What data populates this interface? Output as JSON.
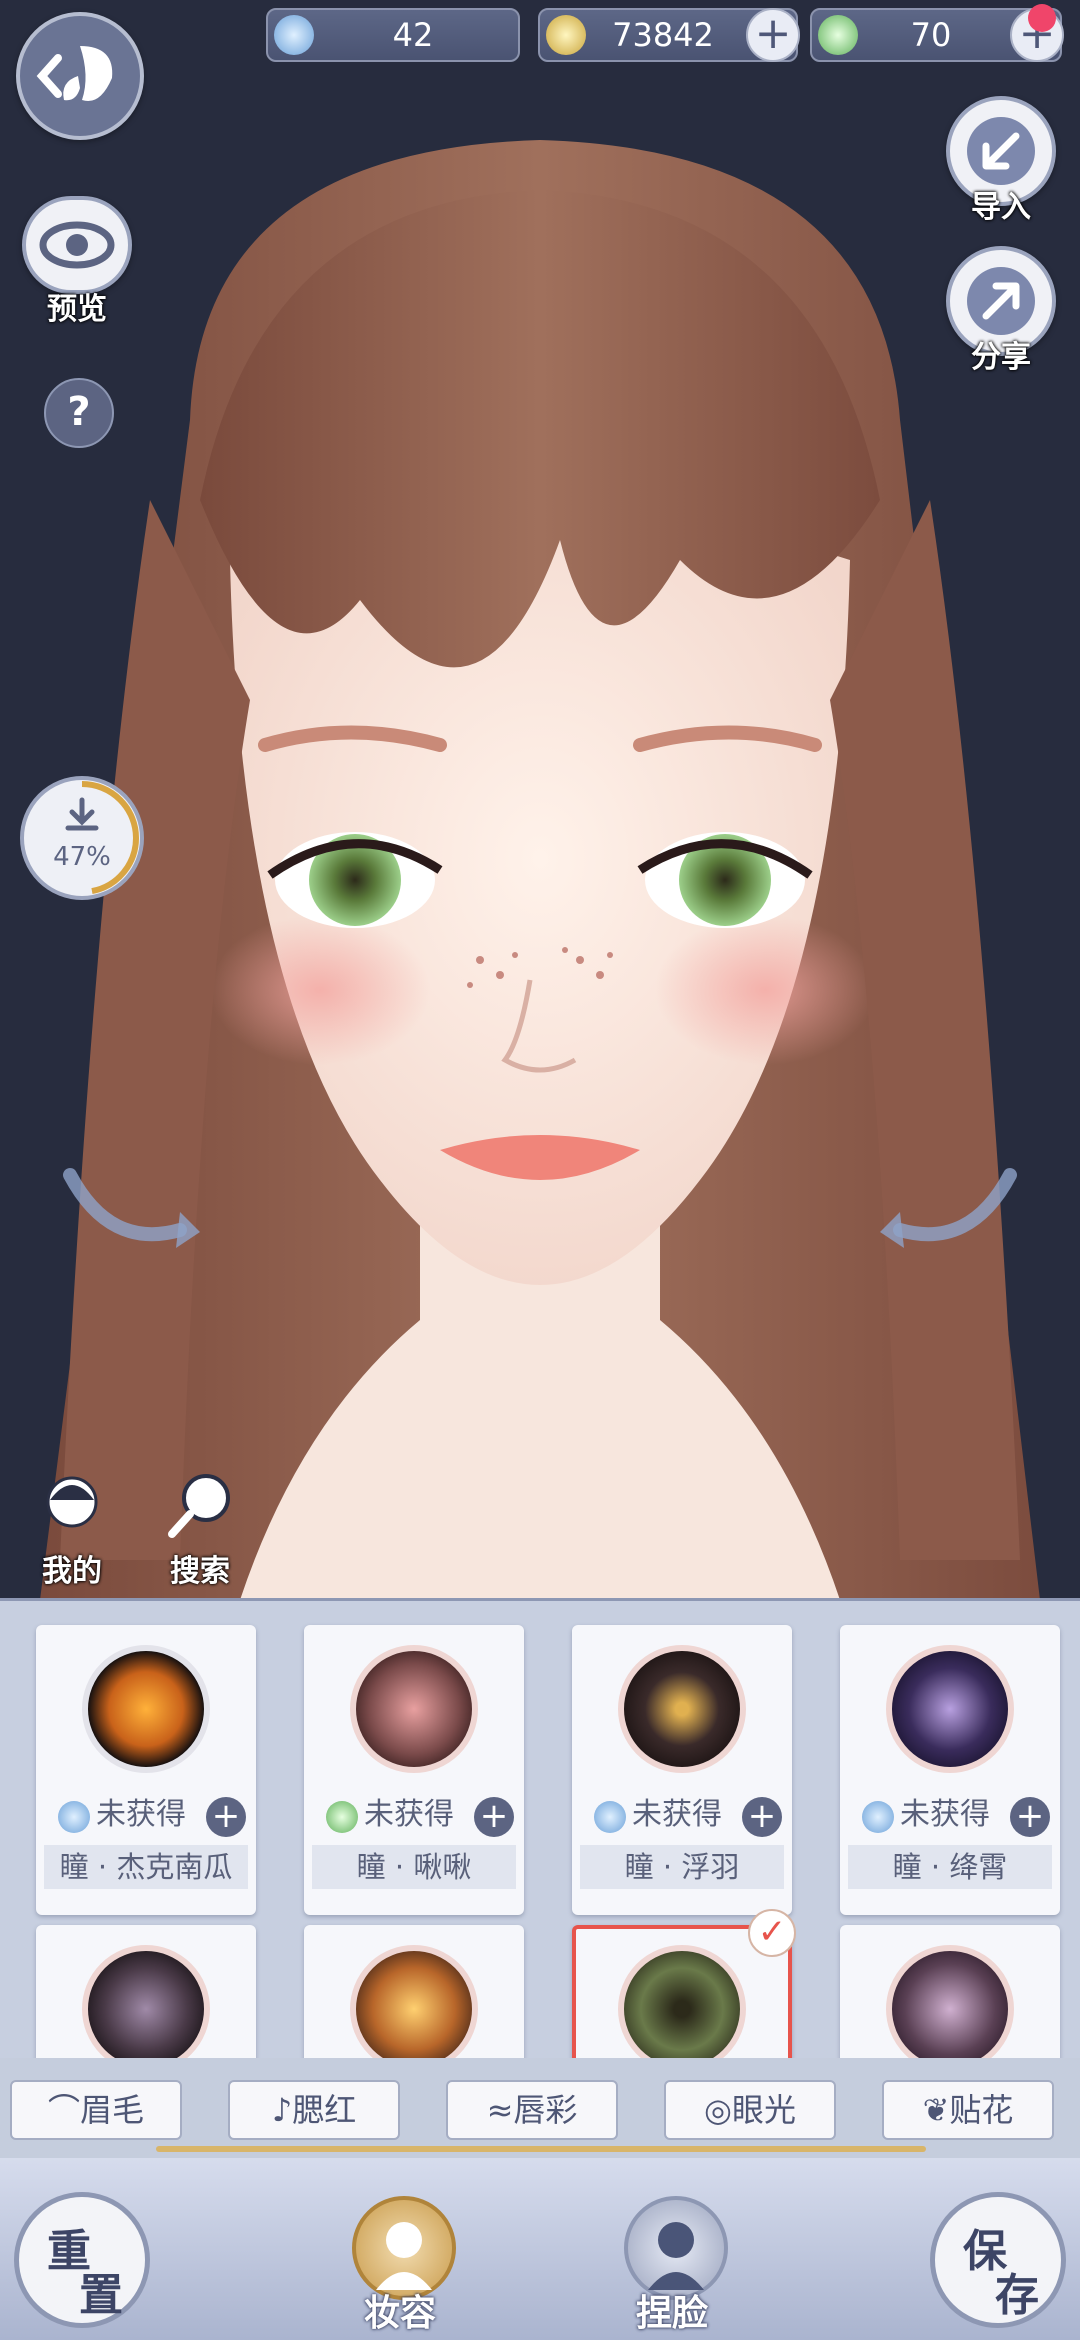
{
  "currencies": [
    {
      "value": "42",
      "icon": "spiral-token-icon",
      "has_plus": false
    },
    {
      "value": "73842",
      "icon": "coin-icon",
      "has_plus": true
    },
    {
      "value": "70",
      "icon": "green-token-icon",
      "has_plus": true
    }
  ],
  "side_left": {
    "preview_label": "预览",
    "help_label": "?",
    "download_progress": "47%",
    "download_fraction": 0.47,
    "my_label": "我的",
    "search_label": "搜索"
  },
  "side_right": {
    "import_label": "导入",
    "share_label": "分享"
  },
  "items": [
    {
      "name": "瞳 · 杰克南瓜",
      "status": "未获得",
      "color": "#c9621a",
      "status_icon": "blue"
    },
    {
      "name": "瞳 · 啾啾",
      "status": "未获得",
      "color": "#7a4a4a",
      "status_icon": "green"
    },
    {
      "name": "瞳 · 浮羽",
      "status": "未获得",
      "color": "#3a2a2a",
      "status_icon": "blue"
    },
    {
      "name": "瞳 · 绛霄",
      "status": "未获得",
      "color": "#3a2c5c",
      "status_icon": "blue"
    },
    {
      "color": "#4a3a48"
    },
    {
      "color": "#b8662a"
    },
    {
      "color": "#6a7a4a",
      "selected": true
    },
    {
      "color": "#5a4054"
    }
  ],
  "tabs": [
    "眉毛",
    "腮红",
    "唇彩",
    "眼光",
    "贴花"
  ],
  "bottom": {
    "reset_label_1": "重",
    "reset_label_2": "置",
    "makeup_label": "妆容",
    "face_label": "捏脸",
    "save_label_1": "保",
    "save_label_2": "存"
  },
  "colors": {
    "panel_bg": "#c7cfe0",
    "accent": "#e7544c",
    "button_dark": "#5c6482"
  }
}
